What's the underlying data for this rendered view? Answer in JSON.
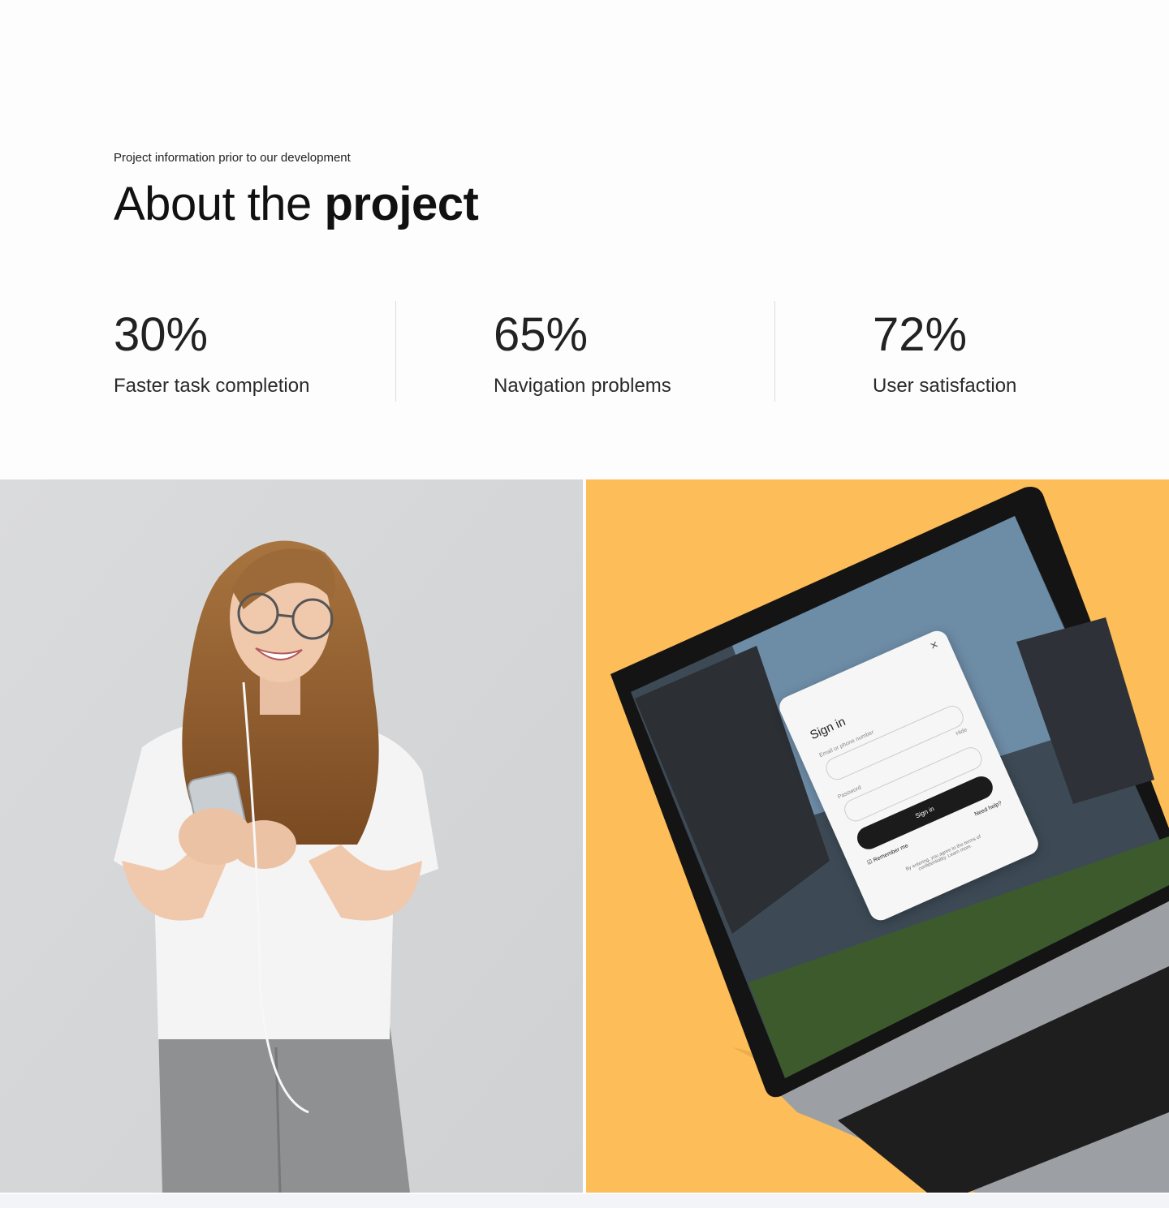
{
  "header": {
    "eyebrow": "Project information prior to our development",
    "title_light": "About the ",
    "title_bold": "project"
  },
  "stats": [
    {
      "value": "30%",
      "label": "Faster task completion"
    },
    {
      "value": "65%",
      "label": "Navigation problems"
    },
    {
      "value": "72%",
      "label": "User satisfaction"
    }
  ],
  "laptop_signin": {
    "title": "Sign in",
    "email_label": "Email or phone number",
    "password_label": "Password",
    "hide_label": "Hide",
    "button_label": "Sign in",
    "remember_label": "Remember me",
    "help_label": "Need help?",
    "terms_line1": "By entering, you agree to the terms of",
    "terms_line2": "confidentiality. Learn more."
  },
  "colors": {
    "accent_yellow": "#fdbd58",
    "photo_bg": "#d7d8da"
  }
}
